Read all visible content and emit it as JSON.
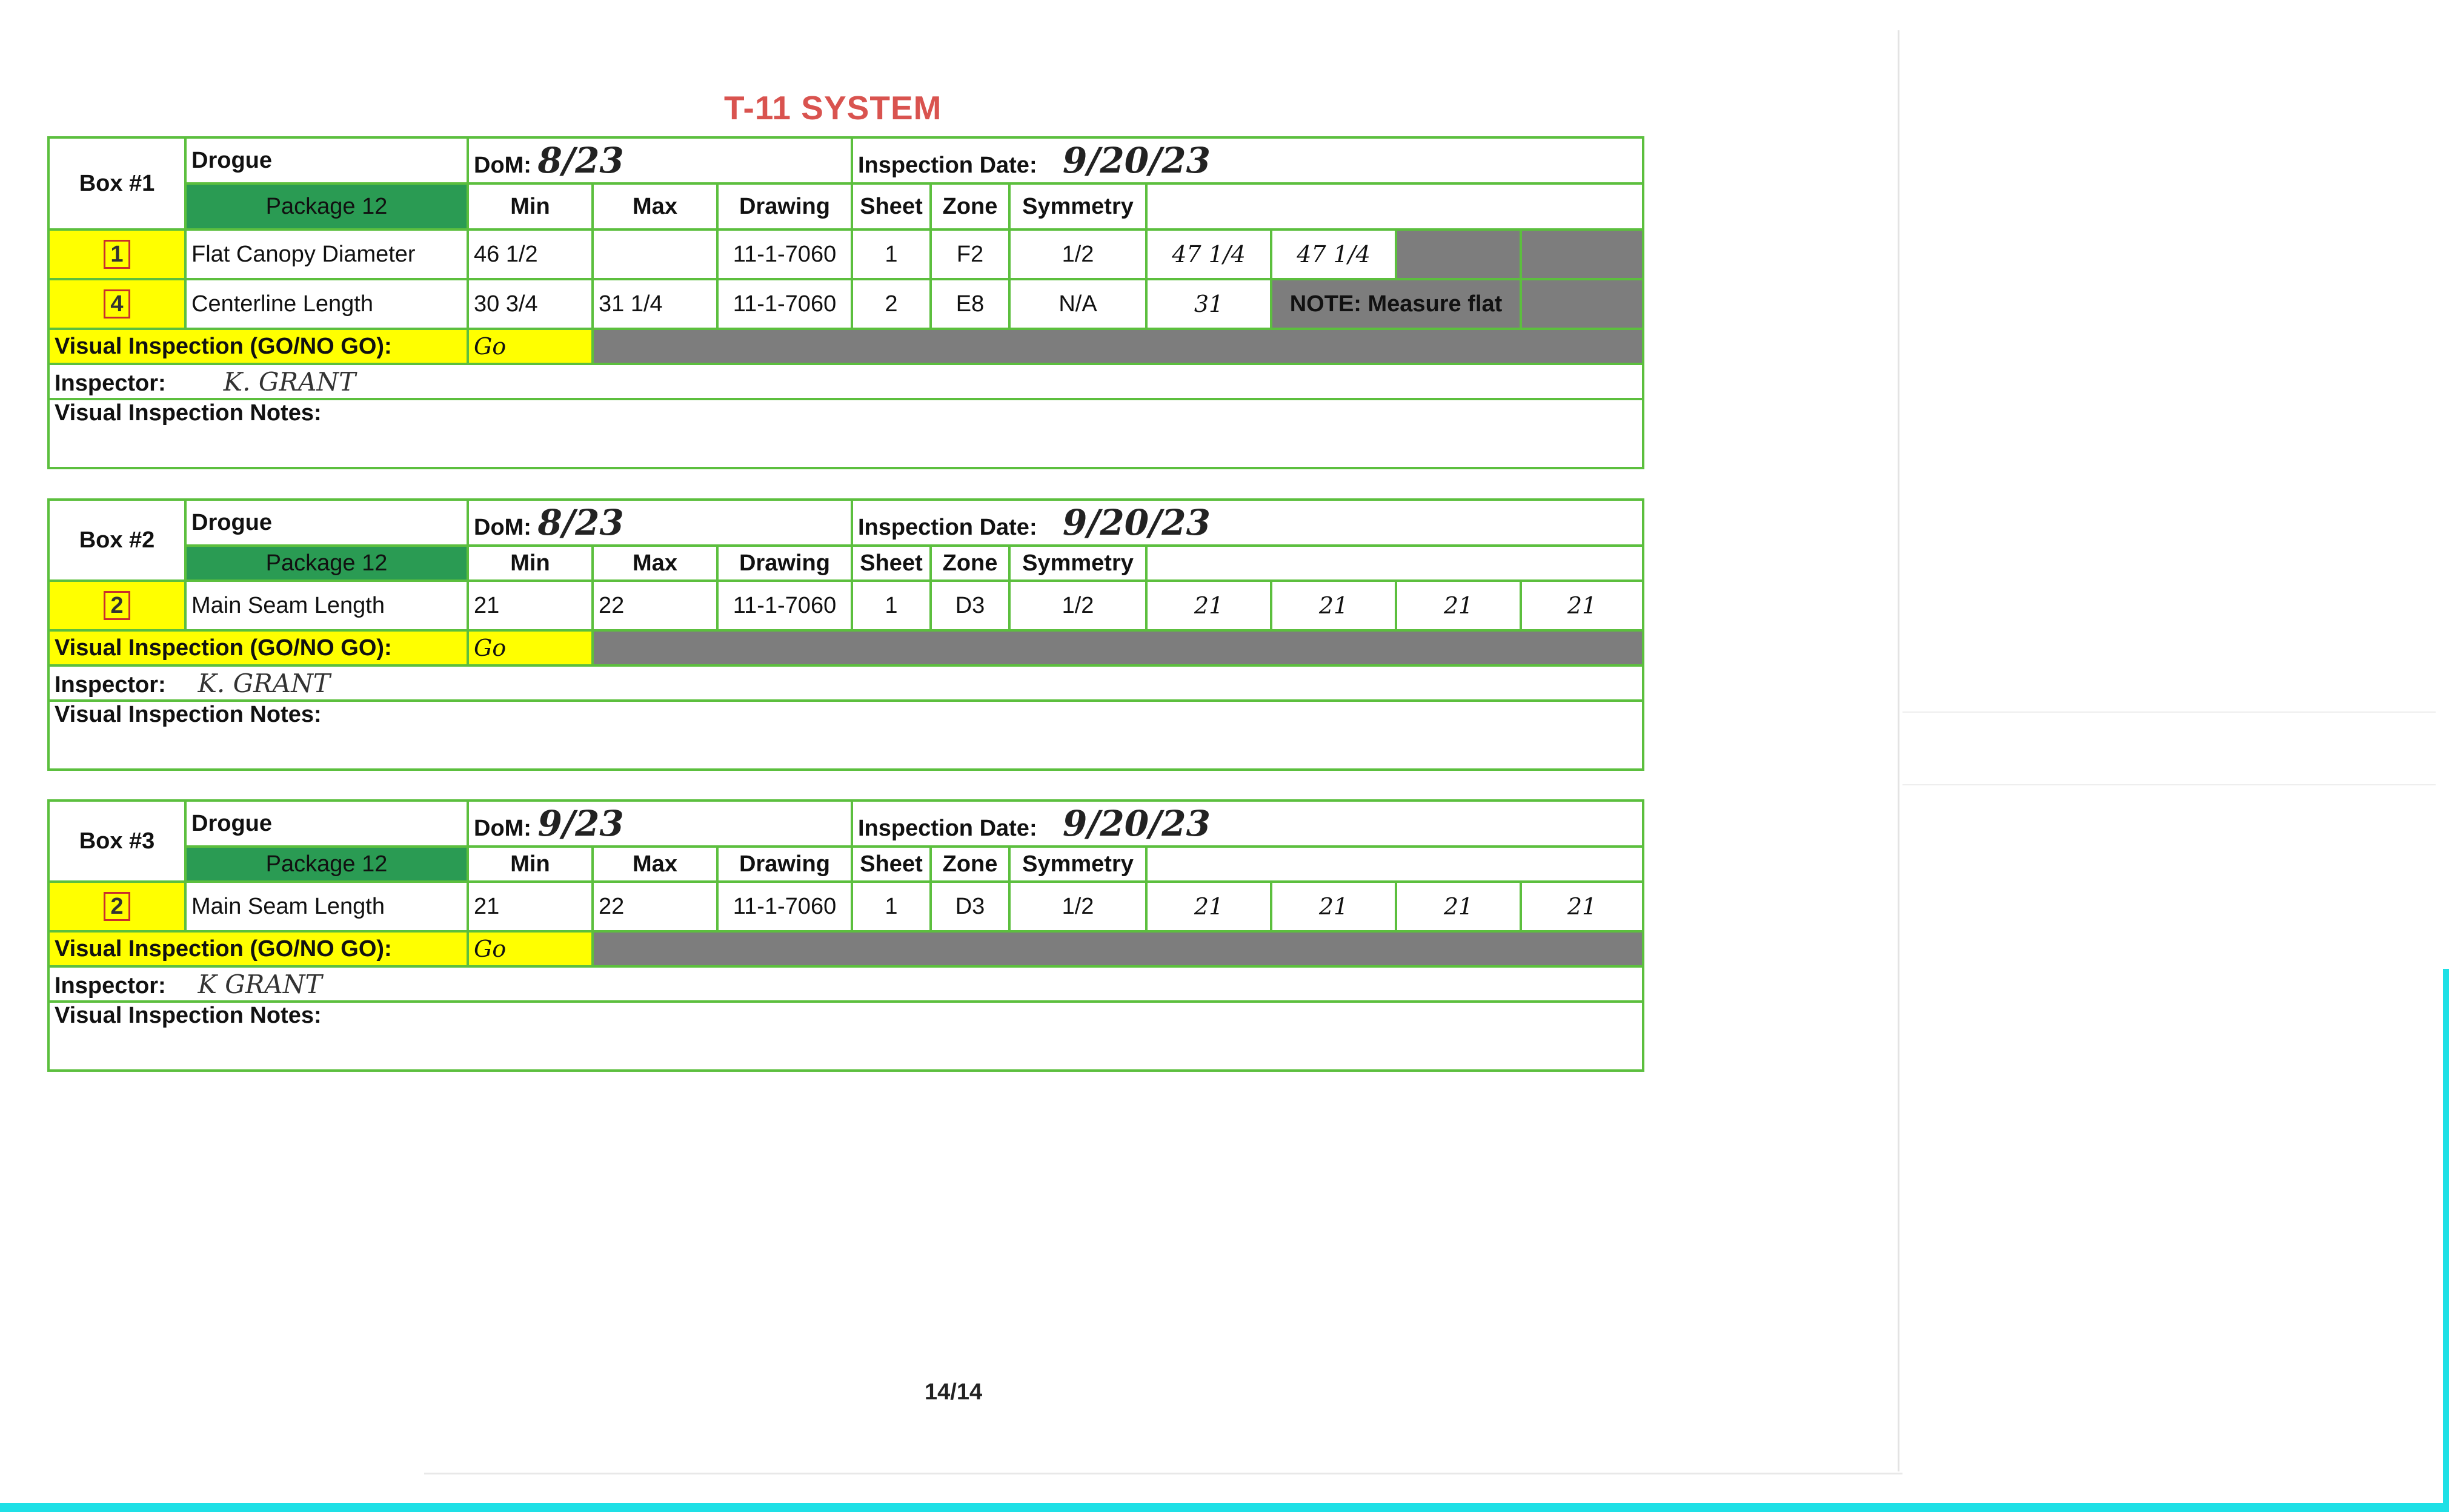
{
  "title": "T-11 SYSTEM",
  "page_number": "14/14",
  "labels": {
    "drogue": "Drogue",
    "package": "Package 12",
    "dom": "DoM:",
    "inspection_date": "Inspection Date:",
    "min": "Min",
    "max": "Max",
    "drawing": "Drawing",
    "sheet": "Sheet",
    "zone": "Zone",
    "symmetry": "Symmetry",
    "visual_inspection": "Visual Inspection (GO/NO GO):",
    "inspector": "Inspector:",
    "notes": "Visual Inspection Notes:"
  },
  "boxes": [
    {
      "label": "Box #1",
      "dom": "8/23",
      "inspection_date": "9/20/23",
      "rows": [
        {
          "qty": "1",
          "name": "Flat Canopy Diameter",
          "min": "46  1/2",
          "max": "",
          "drawing": "11-1-7060",
          "sheet": "1",
          "zone": "F2",
          "symmetry": "1/2",
          "measurements": [
            "47 1/4",
            "47 1/4"
          ],
          "note": ""
        },
        {
          "qty": "4",
          "name": "Centerline Length",
          "min": "30  3/4",
          "max": "31  1/4",
          "drawing": "11-1-7060",
          "sheet": "2",
          "zone": "E8",
          "symmetry": "N/A",
          "measurements": [
            "31"
          ],
          "note": "NOTE: Measure flat"
        }
      ],
      "visual": "Go",
      "inspector": "K.   GRANT",
      "notes": ""
    },
    {
      "label": "Box #2",
      "dom": "8/23",
      "inspection_date": "9/20/23",
      "rows": [
        {
          "qty": "2",
          "name": "Main Seam Length",
          "min": "21",
          "max": "22",
          "drawing": "11-1-7060",
          "sheet": "1",
          "zone": "D3",
          "symmetry": "1/2",
          "measurements": [
            "21",
            "21",
            "21",
            "21"
          ]
        }
      ],
      "visual": "Go",
      "inspector": "K.   GRANT",
      "notes": ""
    },
    {
      "label": "Box #3",
      "dom": "9/23",
      "inspection_date": "9/20/23",
      "rows": [
        {
          "qty": "2",
          "name": "Main Seam Length",
          "min": "21",
          "max": "22",
          "drawing": "11-1-7060",
          "sheet": "1",
          "zone": "D3",
          "symmetry": "1/2",
          "measurements": [
            "21",
            "21",
            "21",
            "21"
          ]
        }
      ],
      "visual": "Go",
      "inspector": "K   GRANT",
      "notes": ""
    }
  ]
}
